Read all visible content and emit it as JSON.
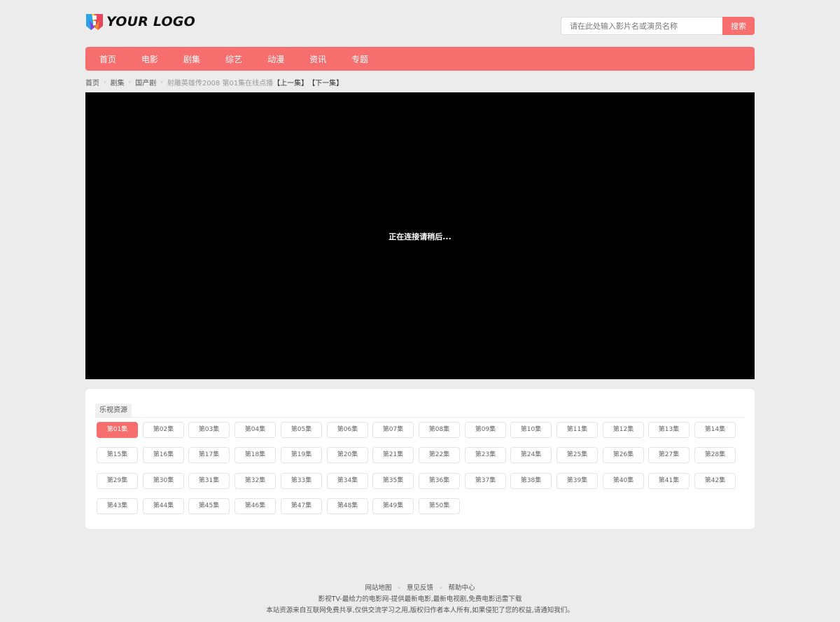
{
  "header": {
    "logo_text": "YOUR LOGO",
    "search_placeholder": "请在此处输入影片名或演员名称",
    "search_button": "搜索"
  },
  "nav": {
    "items": [
      "首页",
      "电影",
      "剧集",
      "综艺",
      "动漫",
      "资讯",
      "专题"
    ]
  },
  "breadcrumb": {
    "home": "首页",
    "category": "剧集",
    "subcategory": "国产剧",
    "current": "射雕英雄传2008 第01集在线点播",
    "prev": "【上一集】",
    "next": "【下一集】"
  },
  "player": {
    "status": "正在连接请稍后..."
  },
  "sources": {
    "tab": "乐视资源",
    "active_episode": "第01集",
    "episodes": [
      "第01集",
      "第02集",
      "第03集",
      "第04集",
      "第05集",
      "第06集",
      "第07集",
      "第08集",
      "第09集",
      "第10集",
      "第11集",
      "第12集",
      "第13集",
      "第14集",
      "第15集",
      "第16集",
      "第17集",
      "第18集",
      "第19集",
      "第20集",
      "第21集",
      "第22集",
      "第23集",
      "第24集",
      "第25集",
      "第26集",
      "第27集",
      "第28集",
      "第29集",
      "第30集",
      "第31集",
      "第32集",
      "第33集",
      "第34集",
      "第35集",
      "第36集",
      "第37集",
      "第38集",
      "第39集",
      "第40集",
      "第41集",
      "第42集",
      "第43集",
      "第44集",
      "第45集",
      "第46集",
      "第47集",
      "第48集",
      "第49集",
      "第50集"
    ]
  },
  "footer": {
    "links": [
      "网站地图",
      "意见反馈",
      "帮助中心"
    ],
    "separator": "-",
    "line2": "影视TV-最给力的电影网-提供最新电影,最新电视剧,免费电影迅雷下载",
    "line3": "本站资源来自互联网免费共享,仅供交流学习之用,版权归作者本人所有,如果侵犯了您的权益,请通知我们。"
  },
  "colors": {
    "accent": "#f76e6e",
    "background": "#ececec",
    "player_bg": "#000000"
  }
}
